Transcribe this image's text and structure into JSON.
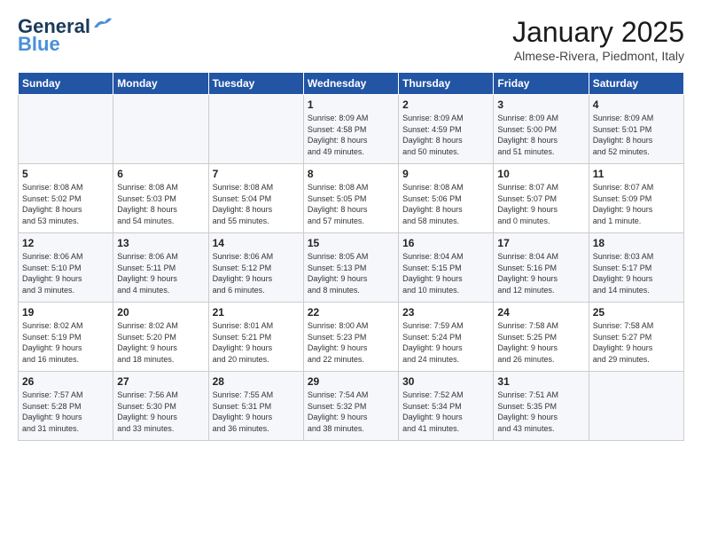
{
  "logo": {
    "line1": "General",
    "line2": "Blue"
  },
  "title": "January 2025",
  "location": "Almese-Rivera, Piedmont, Italy",
  "weekdays": [
    "Sunday",
    "Monday",
    "Tuesday",
    "Wednesday",
    "Thursday",
    "Friday",
    "Saturday"
  ],
  "weeks": [
    [
      {
        "day": "",
        "info": ""
      },
      {
        "day": "",
        "info": ""
      },
      {
        "day": "",
        "info": ""
      },
      {
        "day": "1",
        "info": "Sunrise: 8:09 AM\nSunset: 4:58 PM\nDaylight: 8 hours\nand 49 minutes."
      },
      {
        "day": "2",
        "info": "Sunrise: 8:09 AM\nSunset: 4:59 PM\nDaylight: 8 hours\nand 50 minutes."
      },
      {
        "day": "3",
        "info": "Sunrise: 8:09 AM\nSunset: 5:00 PM\nDaylight: 8 hours\nand 51 minutes."
      },
      {
        "day": "4",
        "info": "Sunrise: 8:09 AM\nSunset: 5:01 PM\nDaylight: 8 hours\nand 52 minutes."
      }
    ],
    [
      {
        "day": "5",
        "info": "Sunrise: 8:08 AM\nSunset: 5:02 PM\nDaylight: 8 hours\nand 53 minutes."
      },
      {
        "day": "6",
        "info": "Sunrise: 8:08 AM\nSunset: 5:03 PM\nDaylight: 8 hours\nand 54 minutes."
      },
      {
        "day": "7",
        "info": "Sunrise: 8:08 AM\nSunset: 5:04 PM\nDaylight: 8 hours\nand 55 minutes."
      },
      {
        "day": "8",
        "info": "Sunrise: 8:08 AM\nSunset: 5:05 PM\nDaylight: 8 hours\nand 57 minutes."
      },
      {
        "day": "9",
        "info": "Sunrise: 8:08 AM\nSunset: 5:06 PM\nDaylight: 8 hours\nand 58 minutes."
      },
      {
        "day": "10",
        "info": "Sunrise: 8:07 AM\nSunset: 5:07 PM\nDaylight: 9 hours\nand 0 minutes."
      },
      {
        "day": "11",
        "info": "Sunrise: 8:07 AM\nSunset: 5:09 PM\nDaylight: 9 hours\nand 1 minute."
      }
    ],
    [
      {
        "day": "12",
        "info": "Sunrise: 8:06 AM\nSunset: 5:10 PM\nDaylight: 9 hours\nand 3 minutes."
      },
      {
        "day": "13",
        "info": "Sunrise: 8:06 AM\nSunset: 5:11 PM\nDaylight: 9 hours\nand 4 minutes."
      },
      {
        "day": "14",
        "info": "Sunrise: 8:06 AM\nSunset: 5:12 PM\nDaylight: 9 hours\nand 6 minutes."
      },
      {
        "day": "15",
        "info": "Sunrise: 8:05 AM\nSunset: 5:13 PM\nDaylight: 9 hours\nand 8 minutes."
      },
      {
        "day": "16",
        "info": "Sunrise: 8:04 AM\nSunset: 5:15 PM\nDaylight: 9 hours\nand 10 minutes."
      },
      {
        "day": "17",
        "info": "Sunrise: 8:04 AM\nSunset: 5:16 PM\nDaylight: 9 hours\nand 12 minutes."
      },
      {
        "day": "18",
        "info": "Sunrise: 8:03 AM\nSunset: 5:17 PM\nDaylight: 9 hours\nand 14 minutes."
      }
    ],
    [
      {
        "day": "19",
        "info": "Sunrise: 8:02 AM\nSunset: 5:19 PM\nDaylight: 9 hours\nand 16 minutes."
      },
      {
        "day": "20",
        "info": "Sunrise: 8:02 AM\nSunset: 5:20 PM\nDaylight: 9 hours\nand 18 minutes."
      },
      {
        "day": "21",
        "info": "Sunrise: 8:01 AM\nSunset: 5:21 PM\nDaylight: 9 hours\nand 20 minutes."
      },
      {
        "day": "22",
        "info": "Sunrise: 8:00 AM\nSunset: 5:23 PM\nDaylight: 9 hours\nand 22 minutes."
      },
      {
        "day": "23",
        "info": "Sunrise: 7:59 AM\nSunset: 5:24 PM\nDaylight: 9 hours\nand 24 minutes."
      },
      {
        "day": "24",
        "info": "Sunrise: 7:58 AM\nSunset: 5:25 PM\nDaylight: 9 hours\nand 26 minutes."
      },
      {
        "day": "25",
        "info": "Sunrise: 7:58 AM\nSunset: 5:27 PM\nDaylight: 9 hours\nand 29 minutes."
      }
    ],
    [
      {
        "day": "26",
        "info": "Sunrise: 7:57 AM\nSunset: 5:28 PM\nDaylight: 9 hours\nand 31 minutes."
      },
      {
        "day": "27",
        "info": "Sunrise: 7:56 AM\nSunset: 5:30 PM\nDaylight: 9 hours\nand 33 minutes."
      },
      {
        "day": "28",
        "info": "Sunrise: 7:55 AM\nSunset: 5:31 PM\nDaylight: 9 hours\nand 36 minutes."
      },
      {
        "day": "29",
        "info": "Sunrise: 7:54 AM\nSunset: 5:32 PM\nDaylight: 9 hours\nand 38 minutes."
      },
      {
        "day": "30",
        "info": "Sunrise: 7:52 AM\nSunset: 5:34 PM\nDaylight: 9 hours\nand 41 minutes."
      },
      {
        "day": "31",
        "info": "Sunrise: 7:51 AM\nSunset: 5:35 PM\nDaylight: 9 hours\nand 43 minutes."
      },
      {
        "day": "",
        "info": ""
      }
    ]
  ]
}
